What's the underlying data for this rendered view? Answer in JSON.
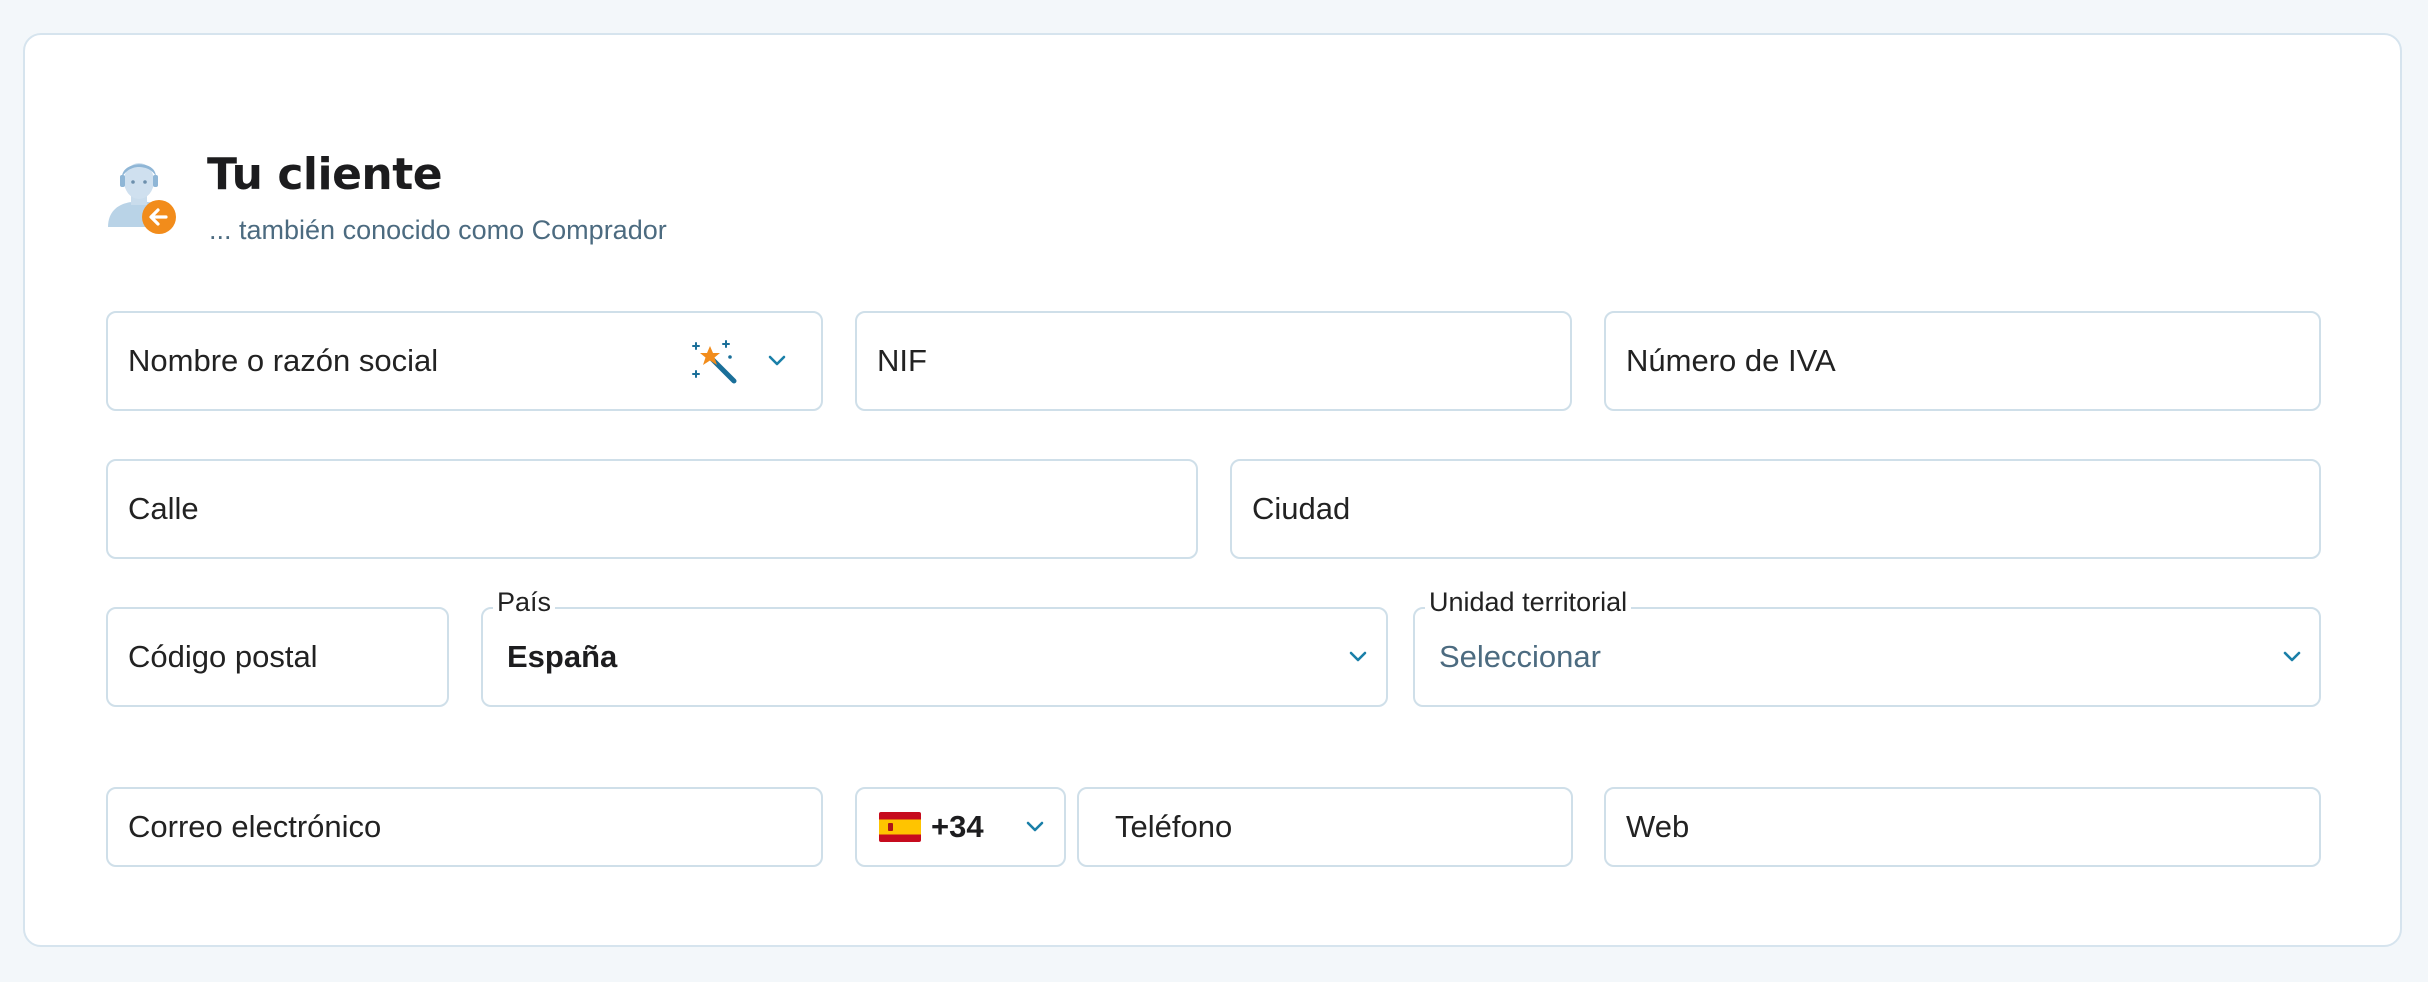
{
  "header": {
    "title": "Tu cliente",
    "subtitle": "... también conocido como Comprador"
  },
  "fields": {
    "nombre": "Nombre o razón social",
    "nif": "NIF",
    "iva": "Número de IVA",
    "calle": "Calle",
    "ciudad": "Ciudad",
    "codigo_postal": "Código postal",
    "pais_label": "País",
    "pais_value": "España",
    "unidad_label": "Unidad territorial",
    "unidad_placeholder": "Seleccionar",
    "correo": "Correo electrónico",
    "phone_code": "+34",
    "telefono": "Teléfono",
    "web": "Web"
  },
  "colors": {
    "accent": "#1a7fa8",
    "badge": "#f28c1b",
    "border": "#cfdfe9"
  },
  "icons": {
    "avatar": "customer-avatar-icon",
    "badge": "arrow-left-icon",
    "magic": "magic-wand-icon",
    "chevron": "chevron-down-icon",
    "flag": "spain-flag-icon"
  }
}
